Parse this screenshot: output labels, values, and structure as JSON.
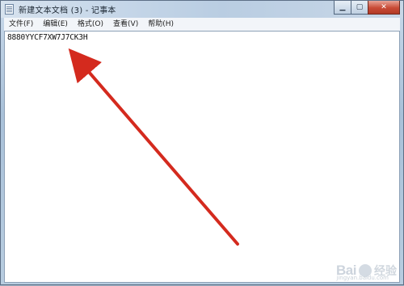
{
  "window": {
    "title": "新建文本文档 (3) - 记事本"
  },
  "menu": [
    {
      "label": "文件(F)"
    },
    {
      "label": "编辑(E)"
    },
    {
      "label": "格式(O)"
    },
    {
      "label": "查看(V)"
    },
    {
      "label": "帮助(H)"
    }
  ],
  "editor": {
    "text": "8880YYCF7XW7J7CK3H"
  },
  "watermark": {
    "logo": "Bai",
    "text": "经验",
    "sub": "jingyan.baidu.com"
  },
  "annotation": {
    "arrow_color": "#d42a1e"
  },
  "icons": {
    "minimize": "minimize-icon",
    "maximize": "maximize-icon",
    "close": "close-icon"
  }
}
